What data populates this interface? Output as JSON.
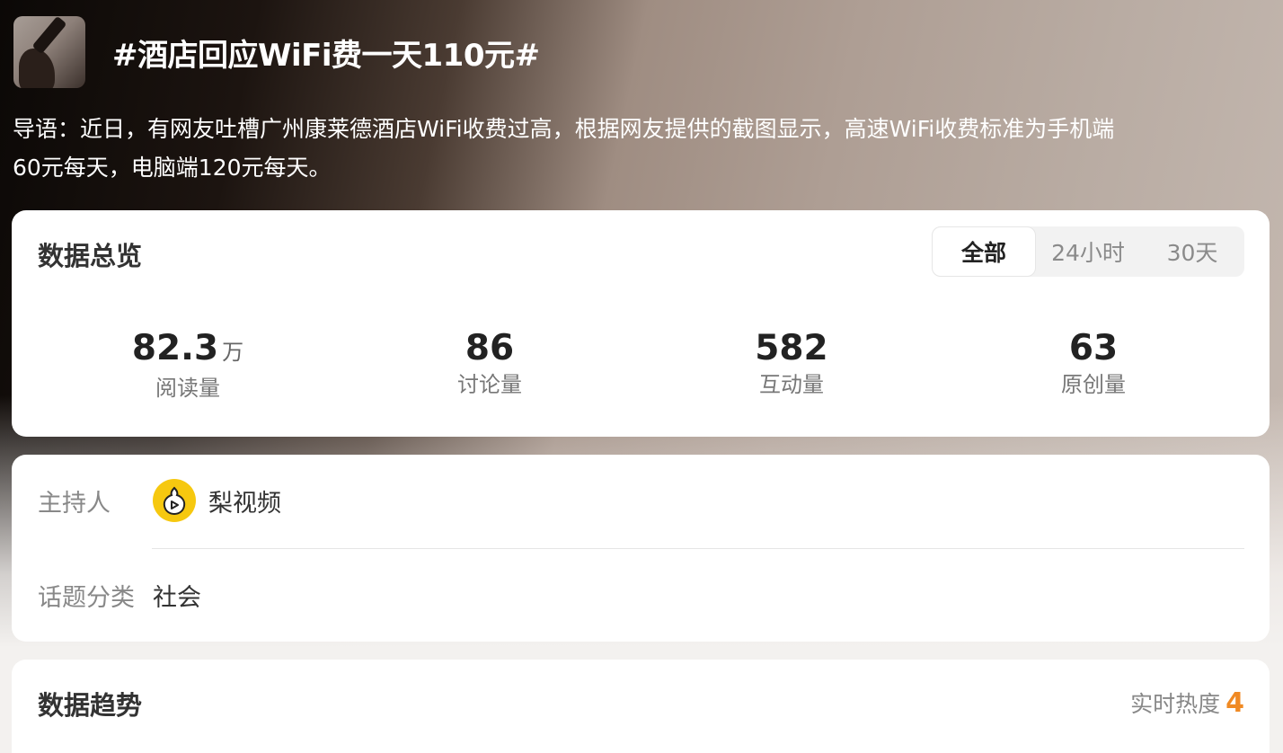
{
  "topic": {
    "title": "#酒店回应WiFi费一天110元#",
    "intro_line1": "导语：近日，有网友吐槽广州康莱德酒店WiFi收费过高，根据网友提供的截图显示，高速WiFi收费标准为手机端",
    "intro_line2": "60元每天，电脑端120元每天。"
  },
  "overview": {
    "title": "数据总览",
    "tabs": [
      "全部",
      "24小时",
      "30天"
    ],
    "active_tab": "全部",
    "stats": [
      {
        "value": "82.3",
        "unit": "万",
        "label": "阅读量"
      },
      {
        "value": "86",
        "unit": "",
        "label": "讨论量"
      },
      {
        "value": "582",
        "unit": "",
        "label": "互动量"
      },
      {
        "value": "63",
        "unit": "",
        "label": "原创量"
      }
    ]
  },
  "info": {
    "host_label": "主持人",
    "host_name": "梨视频",
    "host_icon": "pear-video-logo-icon",
    "category_label": "话题分类",
    "category_value": "社会"
  },
  "trend": {
    "title": "数据趋势",
    "heat_label": "实时热度",
    "heat_value": "4"
  },
  "colors": {
    "accent": "#f08a24",
    "host_avatar": "#f6c80f"
  }
}
